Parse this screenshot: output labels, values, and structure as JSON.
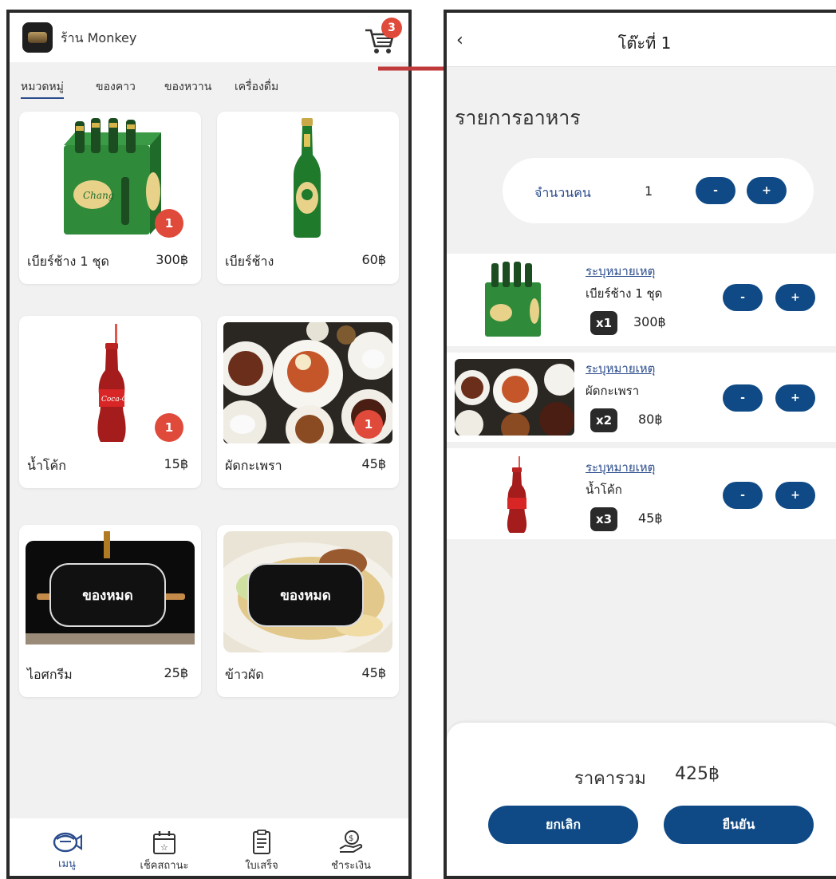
{
  "left": {
    "header": {
      "shop_name": "ร้าน  Monkey",
      "cart_count": "3"
    },
    "tabs": [
      "หมวดหมู่",
      "ของคาว",
      "ของหวาน",
      "เครื่องดื่ม"
    ],
    "products": [
      {
        "name": "เบียร์ช้าง 1 ชุด",
        "price": "300฿",
        "badge": "1"
      },
      {
        "name": "เบียร์ช้าง",
        "price": "60฿"
      },
      {
        "name": "น้ำโค้ก",
        "price": "15฿",
        "badge": "1"
      },
      {
        "name": "ผัดกะเพรา",
        "price": "45฿",
        "badge": "1"
      },
      {
        "name": "ไอศกรีม",
        "price": "25฿",
        "soldout": "ของหมด"
      },
      {
        "name": "ข้าวผัด",
        "price": "45฿",
        "soldout": "ของหมด"
      }
    ],
    "nav": [
      {
        "label": "เมนู",
        "icon": "sushi-icon"
      },
      {
        "label": "เช็คสถานะ",
        "icon": "calendar-star-icon"
      },
      {
        "label": "ใบเสร็จ",
        "icon": "receipt-icon"
      },
      {
        "label": "ชำระเงิน",
        "icon": "payment-hand-icon"
      }
    ]
  },
  "right": {
    "header": {
      "title": "โต๊ะที่ 1"
    },
    "section_title": "รายการอาหาร",
    "people": {
      "label": "จำนวนคน",
      "count": "1",
      "minus": "-",
      "plus": "+"
    },
    "orders": [
      {
        "remark": "ระบุหมายเหตุ",
        "name": "เบียร์ช้าง 1 ชุด",
        "qty": "x1",
        "price": "300฿"
      },
      {
        "remark": "ระบุหมายเหตุ",
        "name": "ผัดกะเพรา",
        "qty": "x2",
        "price": "80฿"
      },
      {
        "remark": "ระบุหมายเหตุ",
        "name": "น้ำโค้ก",
        "qty": "x3",
        "price": "45฿"
      }
    ],
    "row_minus": "-",
    "row_plus": "+",
    "total": {
      "label": "ราคารวม",
      "value": "425฿"
    },
    "buttons": {
      "cancel": "ยกเลิก",
      "confirm": "ยืนยัน"
    }
  },
  "colors": {
    "primary": "#0f4a86",
    "badge": "#e04a3a",
    "arrow": "#c0393b"
  }
}
